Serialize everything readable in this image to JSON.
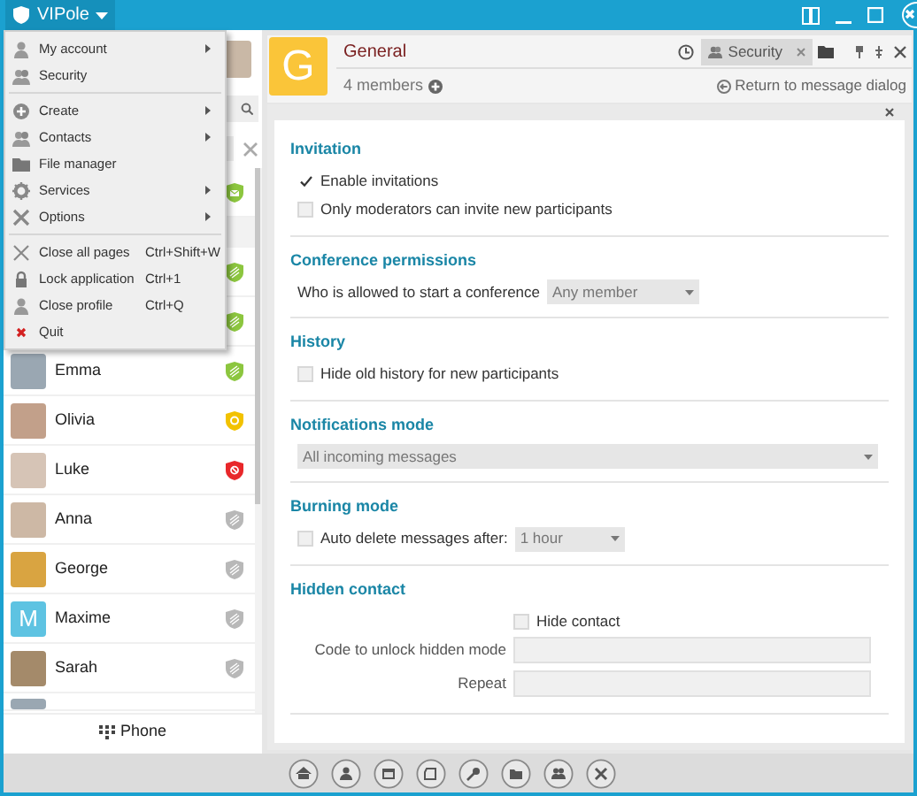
{
  "app_menu_button": {
    "label": "VIPole"
  },
  "main_menu": [
    {
      "label": "My account",
      "submenu": true,
      "divider_after": false
    },
    {
      "label": "Security",
      "submenu": false,
      "divider_after": true
    },
    {
      "label": "Create",
      "submenu": true,
      "divider_after": false
    },
    {
      "label": "Contacts",
      "submenu": true,
      "divider_after": false
    },
    {
      "label": "File manager",
      "submenu": false,
      "divider_after": false
    },
    {
      "label": "Services",
      "submenu": true,
      "divider_after": false
    },
    {
      "label": "Options",
      "submenu": true,
      "divider_after": true
    },
    {
      "label": "Close all pages",
      "shortcut": "Ctrl+Shift+W",
      "submenu": false,
      "divider_after": false
    },
    {
      "label": "Lock application",
      "shortcut": "Ctrl+1",
      "submenu": false,
      "divider_after": false
    },
    {
      "label": "Close profile",
      "shortcut": "Ctrl+Q",
      "submenu": false,
      "divider_after": false
    },
    {
      "label": "Quit",
      "submenu": false,
      "divider_after": false
    }
  ],
  "contacts": [
    {
      "kind": "contact",
      "badge": {
        "kind": "message",
        "color": "#8cc63f"
      }
    },
    {
      "kind": "group"
    },
    {
      "kind": "contact",
      "badge": {
        "kind": "secure",
        "color": "#8cc63f"
      }
    },
    {
      "kind": "contact",
      "badge": {
        "kind": "secure",
        "color": "#8cc63f"
      }
    },
    {
      "kind": "contact",
      "name": "Emma",
      "avatar": {
        "kind": "photo"
      },
      "badge": {
        "kind": "secure",
        "color": "#8cc63f"
      }
    },
    {
      "kind": "contact",
      "name": "Olivia",
      "avatar": {
        "kind": "photo"
      },
      "badge": {
        "kind": "pending",
        "color": "#f2c200"
      }
    },
    {
      "kind": "contact",
      "name": "Luke",
      "avatar": {
        "kind": "photo"
      },
      "badge": {
        "kind": "blocked",
        "color": "#e8272a"
      }
    },
    {
      "kind": "contact",
      "name": "Anna",
      "avatar": {
        "kind": "photo"
      },
      "badge": {
        "kind": "offline",
        "color": "#b8b8b8"
      }
    },
    {
      "kind": "contact",
      "name": "George",
      "avatar": {
        "kind": "photo"
      },
      "badge": {
        "kind": "offline",
        "color": "#b8b8b8"
      }
    },
    {
      "kind": "contact",
      "name": "Maxime",
      "avatar": {
        "kind": "letter",
        "letter": "M"
      },
      "badge": {
        "kind": "offline",
        "color": "#b8b8b8"
      }
    },
    {
      "kind": "contact",
      "name": "Sarah",
      "avatar": {
        "kind": "photo"
      },
      "badge": {
        "kind": "offline",
        "color": "#b8b8b8"
      }
    },
    {
      "kind": "partial_contact",
      "avatar": {
        "kind": "photo"
      }
    }
  ],
  "phone_button": {
    "label": "Phone"
  },
  "conversation": {
    "letter": "G",
    "title": "General",
    "members": "4 members",
    "tabs": [
      {
        "label": "Security",
        "selected": true
      }
    ],
    "return_link": "Return to message dialog"
  },
  "sections": [
    {
      "title": "Invitation",
      "items": [
        {
          "kind": "checkbox",
          "label": "Enable invitations",
          "checked": true
        },
        {
          "kind": "checkbox",
          "label": "Only moderators can invite new participants",
          "checked": false
        }
      ]
    },
    {
      "title": "Conference permissions",
      "items": [
        {
          "kind": "labeled_select",
          "label": "Who is allowed to start a conference",
          "value": "Any member"
        }
      ]
    },
    {
      "title": "History",
      "items": [
        {
          "kind": "checkbox",
          "label": "Hide old history for new participants",
          "checked": false
        }
      ]
    },
    {
      "title": "Notifications mode",
      "items": [
        {
          "kind": "select",
          "value": "All incoming messages"
        }
      ]
    },
    {
      "title": "Burning mode",
      "items": [
        {
          "kind": "checkbox_select",
          "label": "Auto delete messages after:",
          "checked": false,
          "value": "1 hour"
        }
      ]
    },
    {
      "title": "Hidden contact",
      "items": [
        {
          "kind": "form_checkbox",
          "label": "Hide contact",
          "checked": false
        },
        {
          "kind": "form_field",
          "label": "Code to unlock hidden mode"
        },
        {
          "kind": "form_field",
          "label": "Repeat"
        }
      ]
    }
  ]
}
